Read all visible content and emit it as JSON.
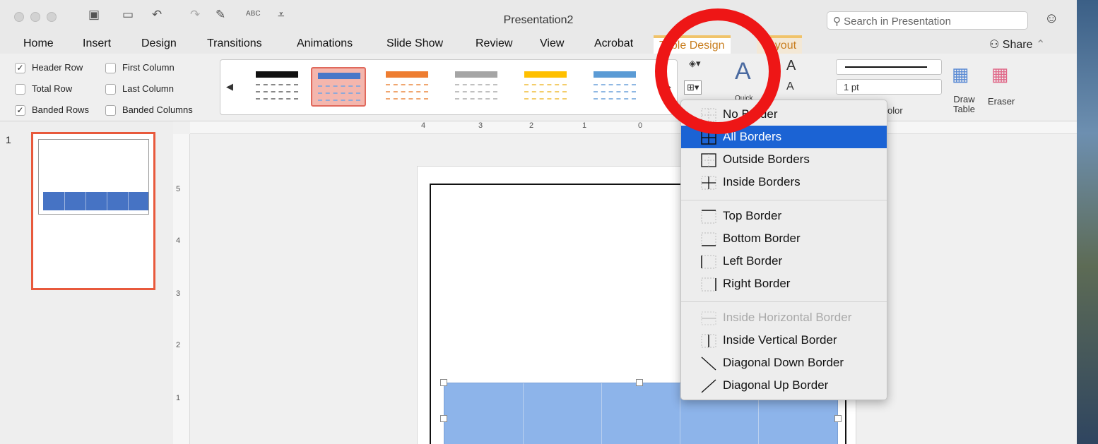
{
  "window": {
    "title": "Presentation2",
    "search_placeholder": "Search in Presentation",
    "share_label": "Share",
    "qa_abc": "ABC"
  },
  "tabs": [
    {
      "label": "Home"
    },
    {
      "label": "Insert"
    },
    {
      "label": "Design"
    },
    {
      "label": "Transitions"
    },
    {
      "label": "Animations"
    },
    {
      "label": "Slide Show"
    },
    {
      "label": "Review"
    },
    {
      "label": "View"
    },
    {
      "label": "Acrobat"
    },
    {
      "label": "Table Design"
    },
    {
      "label": "Layout"
    }
  ],
  "ribbon": {
    "options": [
      {
        "label": "Header Row",
        "checked": true
      },
      {
        "label": "First Column",
        "checked": false
      },
      {
        "label": "Total Row",
        "checked": false
      },
      {
        "label": "Last Column",
        "checked": false
      },
      {
        "label": "Banded Rows",
        "checked": true
      },
      {
        "label": "Banded Columns",
        "checked": false
      }
    ],
    "styles": [
      {
        "header": "#111111",
        "band": "#888888",
        "selected": false
      },
      {
        "header": "#4a78c8",
        "band": "#8fa9d8",
        "selected": true
      },
      {
        "header": "#ee7d31",
        "band": "#f0a670",
        "selected": false
      },
      {
        "header": "#a5a5a5",
        "band": "#c0c0c0",
        "selected": false
      },
      {
        "header": "#ffc000",
        "band": "#f3cd6a",
        "selected": false
      },
      {
        "header": "#5b9bd5",
        "band": "#8fb8e3",
        "selected": false
      }
    ],
    "pen_weight": "1 pt",
    "pen_color_label": "olor",
    "quick_label": "Quick",
    "draw_table_label": "Draw Table",
    "eraser_label": "Eraser"
  },
  "slides": [
    {
      "number": "1"
    }
  ],
  "rulers": {
    "horizontal": [
      "4",
      "3",
      "2",
      "1",
      "0"
    ],
    "vertical": [
      "5",
      "4",
      "3",
      "2",
      "1"
    ]
  },
  "border_menu": {
    "groups": [
      [
        {
          "label": "No Border",
          "icon": "no-border-icon",
          "highlighted": false,
          "disabled": false
        },
        {
          "label": "All Borders",
          "icon": "all-borders-icon",
          "highlighted": true,
          "disabled": false
        },
        {
          "label": "Outside Borders",
          "icon": "outside-borders-icon",
          "highlighted": false,
          "disabled": false
        },
        {
          "label": "Inside Borders",
          "icon": "inside-borders-icon",
          "highlighted": false,
          "disabled": false
        }
      ],
      [
        {
          "label": "Top Border",
          "icon": "top-border-icon",
          "highlighted": false,
          "disabled": false
        },
        {
          "label": "Bottom Border",
          "icon": "bottom-border-icon",
          "highlighted": false,
          "disabled": false
        },
        {
          "label": "Left Border",
          "icon": "left-border-icon",
          "highlighted": false,
          "disabled": false
        },
        {
          "label": "Right Border",
          "icon": "right-border-icon",
          "highlighted": false,
          "disabled": false
        }
      ],
      [
        {
          "label": "Inside Horizontal Border",
          "icon": "inside-horizontal-border-icon",
          "highlighted": false,
          "disabled": true
        },
        {
          "label": "Inside Vertical Border",
          "icon": "inside-vertical-border-icon",
          "highlighted": false,
          "disabled": false
        },
        {
          "label": "Diagonal Down Border",
          "icon": "diagonal-down-border-icon",
          "highlighted": false,
          "disabled": false
        },
        {
          "label": "Diagonal Up Border",
          "icon": "diagonal-up-border-icon",
          "highlighted": false,
          "disabled": false
        }
      ]
    ]
  },
  "colors": {
    "highlight": "#1b63d4",
    "annotation": "#ee1616",
    "table_fill": "#8db4ea",
    "thumb_selected": "#e8593c"
  }
}
